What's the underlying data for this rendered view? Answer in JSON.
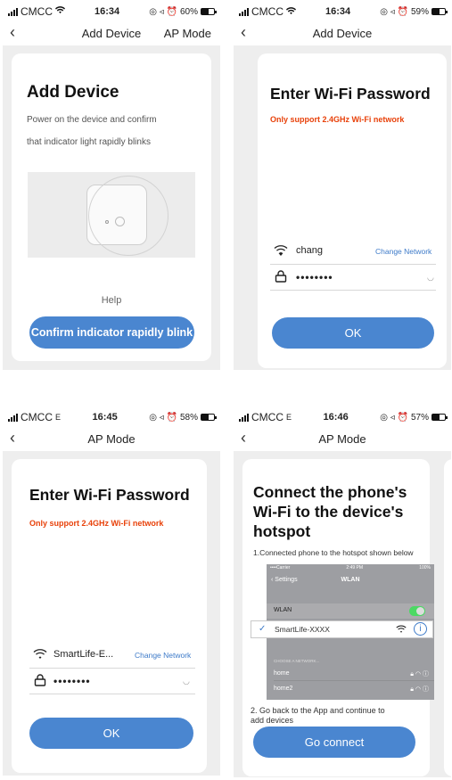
{
  "statusbars": [
    {
      "carrier": "CMCC",
      "net": "",
      "time": "16:34",
      "battery": "60%",
      "battery_level": 0.6
    },
    {
      "carrier": "CMCC",
      "net": "",
      "time": "16:34",
      "battery": "59%",
      "battery_level": 0.59
    },
    {
      "carrier": "CMCC",
      "net": "E",
      "time": "16:45",
      "battery": "58%",
      "battery_level": 0.58
    },
    {
      "carrier": "CMCC",
      "net": "E",
      "time": "16:46",
      "battery": "57%",
      "battery_level": 0.57
    }
  ],
  "icons": {
    "back": "chevron-left-icon",
    "wifi": "wifi-icon",
    "lock": "lock-icon",
    "eye": "eye-closed-icon",
    "info": "info-icon",
    "check": "checkmark-icon"
  },
  "colors": {
    "accent": "#4a86d0",
    "warning": "#e8410a",
    "link": "#3e7bc9",
    "background": "#eeeeee"
  },
  "screen1": {
    "nav_title": "Add Device",
    "nav_right": "AP Mode",
    "title": "Add Device",
    "desc_line1": "Power on the device and confirm",
    "desc_line2": "that indicator light rapidly blinks",
    "help": "Help",
    "button": "Confirm indicator rapidly blink"
  },
  "screen2": {
    "nav_title": "Add Device",
    "title": "Enter Wi-Fi Password",
    "hint": "Only support 2.4GHz Wi-Fi network",
    "ssid": "chang",
    "change_network": "Change Network",
    "password_mask": "••••••••",
    "button": "OK"
  },
  "screen3": {
    "nav_title": "AP Mode",
    "title": "Enter Wi-Fi Password",
    "hint": "Only support 2.4GHz Wi-Fi network",
    "ssid": "SmartLife-E...",
    "change_network": "Change Network",
    "password_mask": "••••••••",
    "button": "OK"
  },
  "screen4": {
    "nav_title": "AP Mode",
    "title_line1": "Connect the phone's",
    "title_line2": "Wi-Fi to the device's",
    "title_line3": "hotspot",
    "step1": "1.Connected phone to the hotspot shown below",
    "mock": {
      "carrier": "••••Carrier",
      "time": "2:49 PM",
      "battery": "100%",
      "back": "Settings",
      "title": "WLAN",
      "wlan_label": "WLAN",
      "wlan_on": true,
      "hotspot": "SmartLife-XXXX",
      "choose": "CHOOSE A NETWORK...",
      "networks": [
        "home",
        "home2"
      ]
    },
    "step2_line1": "2. Go back to the App and continue to",
    "step2_line2": "add devices",
    "button": "Go connect"
  }
}
